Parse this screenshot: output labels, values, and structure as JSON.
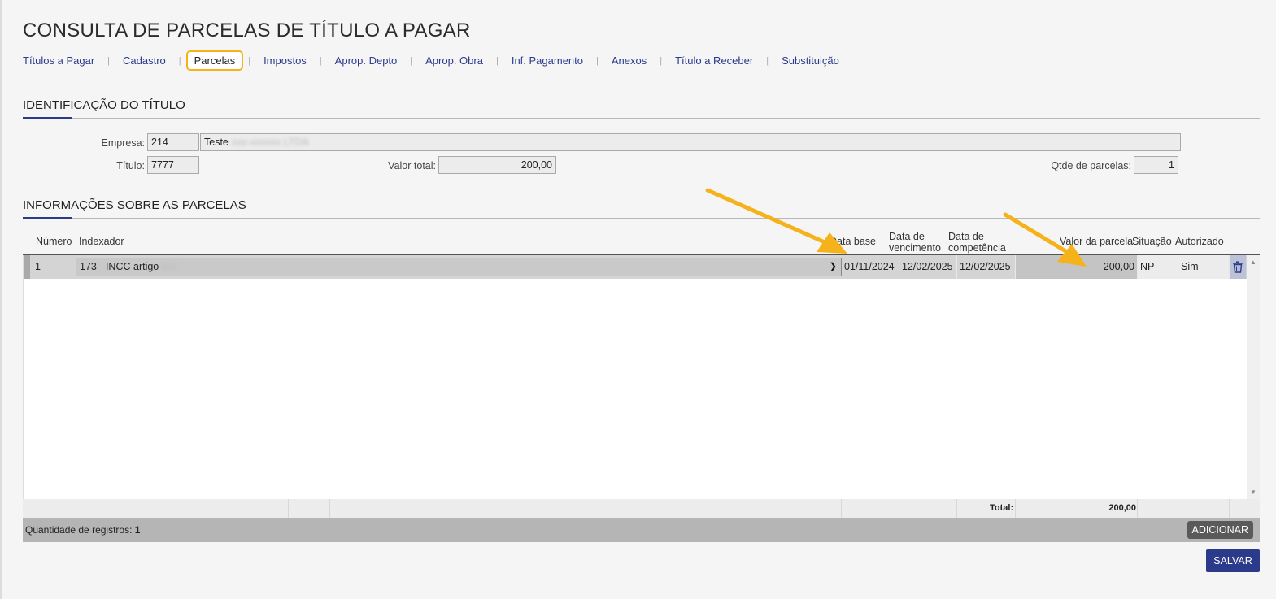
{
  "page": {
    "title": "CONSULTA DE PARCELAS DE TÍTULO A PAGAR",
    "accent_color": "#2c3a8c",
    "highlight_color": "#f5b21b"
  },
  "tabs": [
    {
      "label": "Títulos a Pagar"
    },
    {
      "label": "Cadastro"
    },
    {
      "label": "Parcelas",
      "active": true
    },
    {
      "label": "Impostos"
    },
    {
      "label": "Aprop. Depto"
    },
    {
      "label": "Aprop. Obra"
    },
    {
      "label": "Inf. Pagamento"
    },
    {
      "label": "Anexos"
    },
    {
      "label": "Título a Receber"
    },
    {
      "label": "Substituição"
    }
  ],
  "identificacao": {
    "section_title": "IDENTIFICAÇÃO DO TÍTULO",
    "empresa_label": "Empresa:",
    "empresa_code": "214",
    "empresa_name": "Teste",
    "empresa_name_blurred": "xxx-xxxxxx LTDA",
    "titulo_label": "Título:",
    "titulo_value": "7777",
    "valor_total_label": "Valor total:",
    "valor_total_value": "200,00",
    "qtde_parcelas_label": "Qtde de parcelas:",
    "qtde_parcelas_value": "1"
  },
  "parcelas": {
    "section_title": "INFORMAÇÕES SOBRE AS PARCELAS",
    "columns": {
      "numero": "Número",
      "indexador": "Indexador",
      "data_base": "Data base",
      "data_venc_1": "Data de",
      "data_venc_2": "vencimento",
      "data_comp_1": "Data de",
      "data_comp_2": "competência",
      "valor_parcela": "Valor da parcela",
      "situacao": "Situação",
      "autorizado": "Autorizado"
    },
    "rows": [
      {
        "numero": "1",
        "indexador": "173 - INCC artigo",
        "indexador_blurred": "xxx",
        "data_base": "01/11/2024",
        "data_vencimento": "12/02/2025",
        "data_competencia": "12/02/2025",
        "valor_parcela": "200,00",
        "situacao": "NP",
        "autorizado": "Sim"
      }
    ],
    "total_label": "Total:",
    "total_value": "200,00",
    "record_count_label": "Quantidade de registros:",
    "record_count": "1",
    "add_button": "ADICIONAR",
    "save_button": "SALVAR"
  }
}
